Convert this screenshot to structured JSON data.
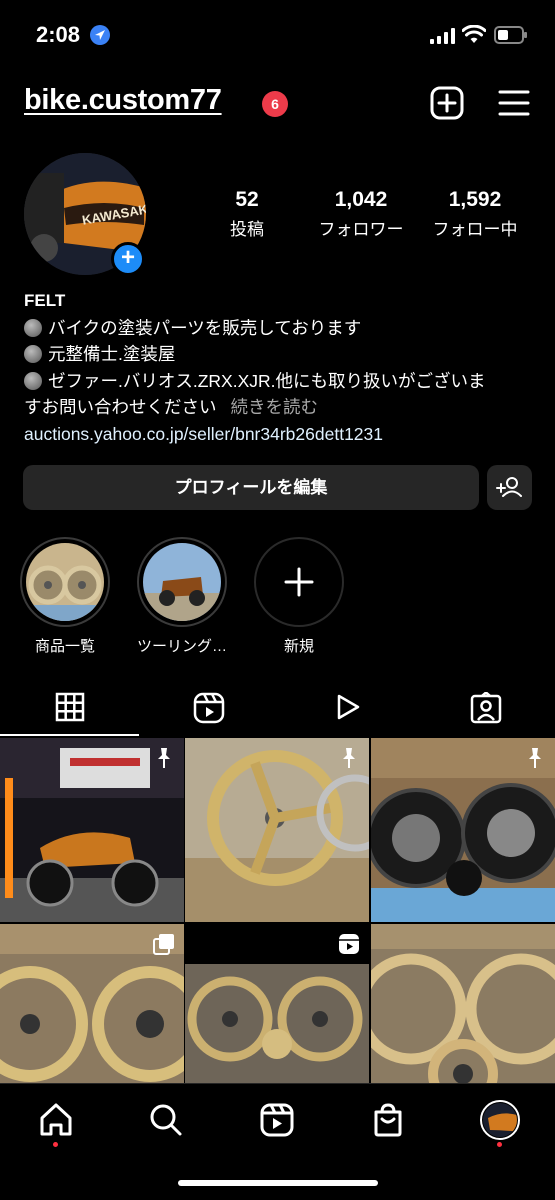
{
  "status_bar": {
    "time": "2:08"
  },
  "header": {
    "username": "bike.custom77",
    "notification_count": "6"
  },
  "profile": {
    "stats": [
      {
        "number": "52",
        "label": "投稿"
      },
      {
        "number": "1,042",
        "label": "フォロワー"
      },
      {
        "number": "1,592",
        "label": "フォロー中"
      }
    ],
    "name": "FELT",
    "bio_lines": [
      "バイクの塗装パーツを販売しております",
      "元整備士.塗装屋",
      "ゼファー.バリオス.ZRX.XJR.他にも取り扱いがございま"
    ],
    "bio_continuation": "すお問い合わせください",
    "more_label": "続きを読む",
    "link": "auctions.yahoo.co.jp/seller/bnr34rb26dett1231",
    "avatar_text": "KAWASAKI"
  },
  "buttons": {
    "edit_profile": "プロフィールを編集"
  },
  "highlights": [
    {
      "label": "商品一覧"
    },
    {
      "label": "ツーリング…"
    },
    {
      "label": "新規"
    }
  ],
  "tabs": [
    {
      "name": "grid",
      "icon": "grid-icon"
    },
    {
      "name": "reels",
      "icon": "reels-icon"
    },
    {
      "name": "videos",
      "icon": "play-icon"
    },
    {
      "name": "tagged",
      "icon": "tagged-icon"
    }
  ],
  "colors": {
    "background": "#000000",
    "badge": "#ed3b4a",
    "accent": "#1d8cf8",
    "button": "#262626",
    "link": "#e0f1ff",
    "muted": "#a8a8a8",
    "nav_dot": "#ff3040"
  }
}
